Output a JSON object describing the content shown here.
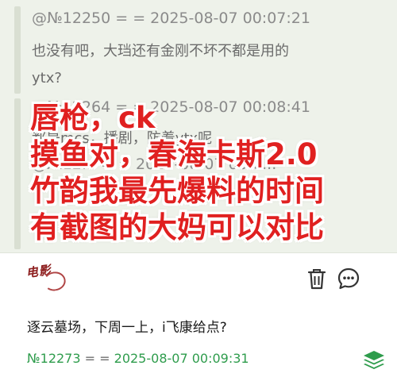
{
  "thread": {
    "messages": [
      {
        "header": "@№12250 = = 2025-08-07 00:07:21"
      },
      {
        "text": "也没有吧，大珰还有金刚不坏不都是用的"
      },
      {
        "text": "ytx?"
      },
      {
        "header": "@№12264 = = 2025-08-07 00:08:41"
      },
      {
        "text": "都是mcs，播剧，防着ytx呢"
      },
      {
        "header": "@№12... = = 2025-08-07 00:0..."
      }
    ]
  },
  "overlay": {
    "lines": [
      "唇枪，ck",
      "摸鱼对，春海卡斯2.0",
      "竹韵我最先爆料的时间",
      "有截图的大妈可以对比"
    ],
    "color": "#e02020"
  },
  "post": {
    "avatar_text": "电影",
    "body": "逐云墓场，下周一上，i飞康给点?",
    "id": "№12273",
    "separator": "= =",
    "timestamp": "2025-08-07 00:09:31",
    "accent_color": "#2e9c4c"
  },
  "icons": {
    "delete": "trash-icon",
    "comment": "comment-icon",
    "layers": "layers-icon"
  }
}
